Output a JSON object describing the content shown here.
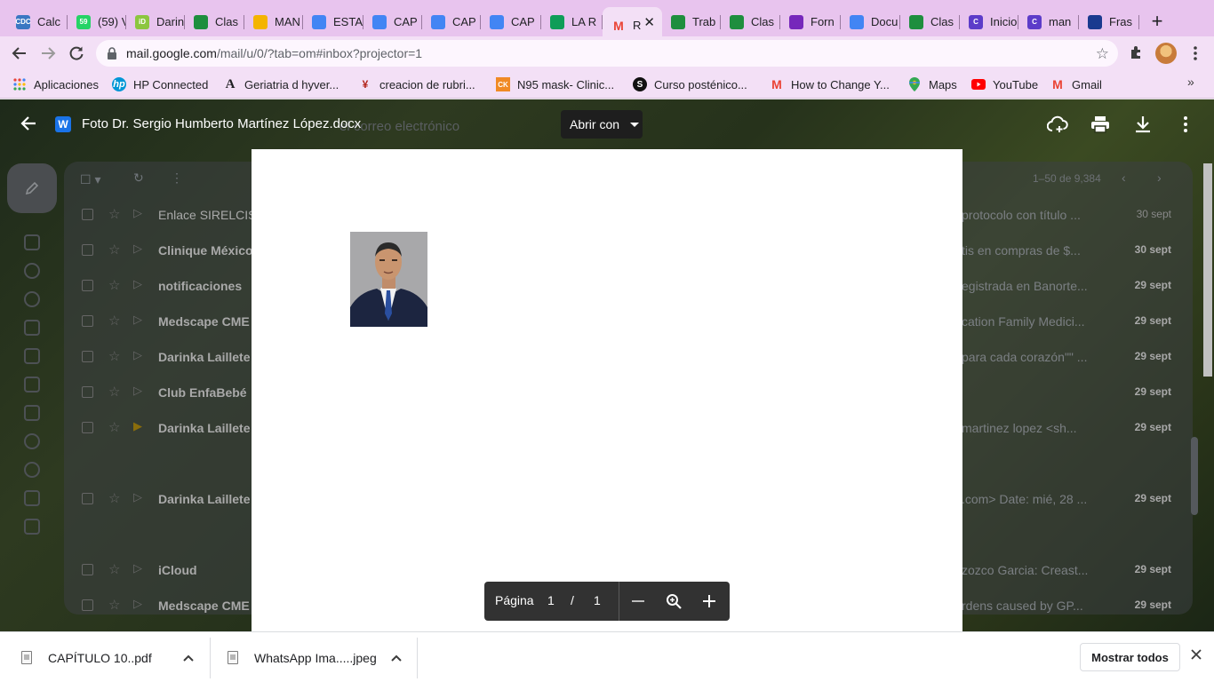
{
  "tabs": [
    {
      "title": "Calc",
      "favicon": "cdc-icon",
      "fav_text": "CDC",
      "fav_color": "#3a77c2"
    },
    {
      "title": "(59) V",
      "favicon": "whatsapp-icon",
      "fav_text": "59",
      "fav_color": "#25d366"
    },
    {
      "title": "Darin",
      "favicon": "id-icon",
      "fav_text": "iD",
      "fav_color": "#8cc63f"
    },
    {
      "title": "Clas",
      "favicon": "classroom-icon",
      "fav_text": "",
      "fav_color": "#1e8e3e"
    },
    {
      "title": "MAN",
      "favicon": "drive-icon",
      "fav_text": "",
      "fav_color": "#f4b400"
    },
    {
      "title": "ESTA",
      "favicon": "docs-icon",
      "fav_text": "",
      "fav_color": "#4285f4"
    },
    {
      "title": "CAP",
      "favicon": "docs-icon",
      "fav_text": "",
      "fav_color": "#4285f4"
    },
    {
      "title": "CAP",
      "favicon": "docs-icon",
      "fav_text": "",
      "fav_color": "#4285f4"
    },
    {
      "title": "CAP",
      "favicon": "docs-icon",
      "fav_text": "",
      "fav_color": "#4285f4"
    },
    {
      "title": "LA R",
      "favicon": "sheets-icon",
      "fav_text": "",
      "fav_color": "#0f9d58"
    },
    {
      "title": "R",
      "favicon": "gmail-icon",
      "fav_text": "M",
      "fav_color": "#ea4335",
      "active": true
    },
    {
      "title": "Trab",
      "favicon": "classroom-icon",
      "fav_text": "",
      "fav_color": "#1e8e3e"
    },
    {
      "title": "Clas",
      "favicon": "classroom-icon",
      "fav_text": "",
      "fav_color": "#1e8e3e"
    },
    {
      "title": "Forn",
      "favicon": "forms-icon",
      "fav_text": "",
      "fav_color": "#7627bb"
    },
    {
      "title": "Docu",
      "favicon": "docs-icon",
      "fav_text": "",
      "fav_color": "#4285f4"
    },
    {
      "title": "Clas",
      "favicon": "classroom-icon",
      "fav_text": "",
      "fav_color": "#1e8e3e"
    },
    {
      "title": "Inicio",
      "favicon": "c-icon",
      "fav_text": "C",
      "fav_color": "#5c3cc9"
    },
    {
      "title": "man",
      "favicon": "c-icon",
      "fav_text": "C",
      "fav_color": "#5c3cc9"
    },
    {
      "title": "Fras",
      "favicon": "bookmark-icon",
      "fav_text": "",
      "fav_color": "#1a3a8f"
    }
  ],
  "address_bar": {
    "host": "mail.google.com",
    "path": "/mail/u/0/?tab=om#inbox?projector=1"
  },
  "bookmarks": [
    {
      "label": "Aplicaciones",
      "icon": "apps-grid-icon"
    },
    {
      "label": "HP Connected",
      "icon": "hp-icon"
    },
    {
      "label": "Geriatria d hyver...",
      "icon": "a-icon"
    },
    {
      "label": "creacion de rubri...",
      "icon": "rubric-icon"
    },
    {
      "label": "N95 mask- Clinic...",
      "icon": "ck-icon"
    },
    {
      "label": "Curso posténico...",
      "icon": "s-icon"
    },
    {
      "label": "How to Change Y...",
      "icon": "gmail-icon"
    },
    {
      "label": "Maps",
      "icon": "maps-icon"
    },
    {
      "label": "YouTube",
      "icon": "youtube-icon"
    },
    {
      "label": "Gmail",
      "icon": "gmail-icon"
    }
  ],
  "viewer": {
    "file_name": "Foto Dr. Sergio Humberto Martínez López.docx",
    "open_with": "Abrir con",
    "pager": {
      "label": "Página",
      "current": "1",
      "separator": "/",
      "total": "1"
    }
  },
  "gmail_background": {
    "search_placeholder": "el correo electrónico",
    "page_count": "1–50 de 9,384",
    "rows": [
      {
        "sender": "Enlace SIRELCIS",
        "snippet": "protocolo con título ...",
        "date": "30 sept",
        "read": true
      },
      {
        "sender": "Clinique México",
        "snippet": "tis en compras de $...",
        "date": "30 sept",
        "read": false
      },
      {
        "sender": "notificaciones",
        "snippet": "egistrada en Banorte...",
        "date": "29 sept",
        "read": false
      },
      {
        "sender": "Medscape CME",
        "snippet": "cation Family Medici...",
        "date": "29 sept",
        "read": false
      },
      {
        "sender": "Darinka Laillete",
        "snippet": "para cada corazón\"\" ...",
        "date": "29 sept",
        "read": false
      },
      {
        "sender": "Club EnfaBebé",
        "snippet": "",
        "date": "29 sept",
        "read": false
      },
      {
        "sender": "Darinka Laillete",
        "snippet": "martinez lopez <sh...",
        "date": "29 sept",
        "read": false,
        "important": true
      },
      {
        "sender": "Darinka Laillete",
        "snippet": ".com> Date: mié, 28 ...",
        "date": "29 sept",
        "read": false
      },
      {
        "sender": "iCloud",
        "snippet": "zozco Garcia: Creast...",
        "date": "29 sept",
        "read": false
      },
      {
        "sender": "Medscape CME",
        "snippet": "rdens caused by GP...",
        "date": "29 sept",
        "read": false
      }
    ]
  },
  "downloads": {
    "items": [
      {
        "name": "CAPÍTULO 10..pdf"
      },
      {
        "name": "WhatsApp Ima.....jpeg"
      }
    ],
    "show_all": "Mostrar todos"
  }
}
